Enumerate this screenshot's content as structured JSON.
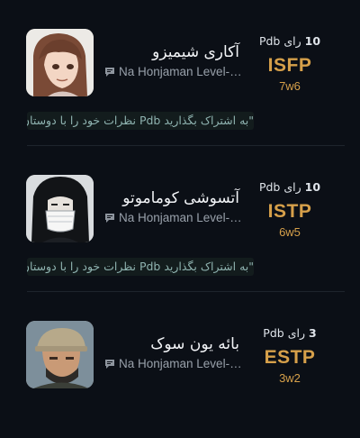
{
  "profiles": [
    {
      "name": "آکاری شیمیزو",
      "source": "Na Honjaman Level-Up...",
      "votes_count": "10",
      "votes_suffix": "رای Pdb",
      "mbti": "ISFP",
      "enneagram": "7w6",
      "share_prompt": "\"به اشتراک بگذارید Pdb نظرات خود را با دوستان\""
    },
    {
      "name": "آتسوشی کوماموتو",
      "source": "Na Honjaman Level-Up...",
      "votes_count": "10",
      "votes_suffix": "رای Pdb",
      "mbti": "ISTP",
      "enneagram": "6w5",
      "share_prompt": "\"به اشتراک بگذارید Pdb نظرات خود را با دوستان\""
    },
    {
      "name": "بائه یون سوک",
      "source": "Na Honjaman Level-Up...",
      "votes_count": "3",
      "votes_suffix": "رای Pdb",
      "mbti": "ESTP",
      "enneagram": "3w2"
    }
  ],
  "colors": {
    "background": "#0b0f16",
    "type_accent": "#d6a04a",
    "share_text": "#8fb3b0"
  },
  "icons": {
    "source": "chat-bubble-icon"
  }
}
